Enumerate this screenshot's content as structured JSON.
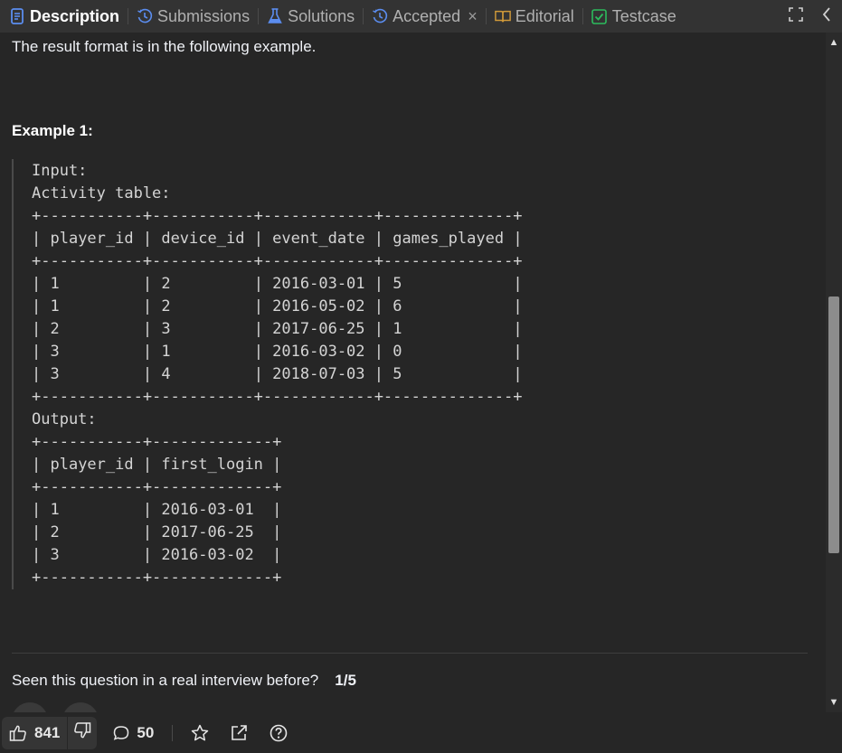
{
  "tabs": [
    {
      "label": "Description",
      "icon": "description-icon",
      "active": true
    },
    {
      "label": "Submissions",
      "icon": "history-icon"
    },
    {
      "label": "Solutions",
      "icon": "flask-icon"
    },
    {
      "label": "Accepted",
      "icon": "history-icon",
      "closable": true
    },
    {
      "label": "Editorial",
      "icon": "book-icon"
    },
    {
      "label": "Testcase",
      "icon": "check-square-icon"
    }
  ],
  "tab_close_glyph": "×",
  "description": {
    "result_format": "The result format is in the following example.",
    "example_title": "Example 1:",
    "input_label": "Input:",
    "table_caption": "Activity table:",
    "input_table": {
      "columns": [
        "player_id",
        "device_id",
        "event_date",
        "games_played"
      ],
      "rows": [
        [
          "1",
          "2",
          "2016-03-01",
          "5"
        ],
        [
          "1",
          "2",
          "2016-05-02",
          "6"
        ],
        [
          "2",
          "3",
          "2017-06-25",
          "1"
        ],
        [
          "3",
          "1",
          "2016-03-02",
          "0"
        ],
        [
          "3",
          "4",
          "2018-07-03",
          "5"
        ]
      ]
    },
    "output_label": "Output:",
    "output_table": {
      "columns": [
        "player_id",
        "first_login"
      ],
      "rows": [
        [
          "1",
          "2016-03-01"
        ],
        [
          "2",
          "2017-06-25"
        ],
        [
          "3",
          "2016-03-02"
        ]
      ]
    }
  },
  "interview": {
    "question": "Seen this question in a real interview before?",
    "fraction": "1/5"
  },
  "footer": {
    "likes": "841",
    "comments": "50"
  },
  "colors": {
    "active_tab_icon": "#5b8def",
    "solutions_icon": "#5b8def",
    "editorial_icon": "#d19a3a",
    "testcase_icon": "#2cbb5d",
    "history_icon": "#5b8def"
  }
}
